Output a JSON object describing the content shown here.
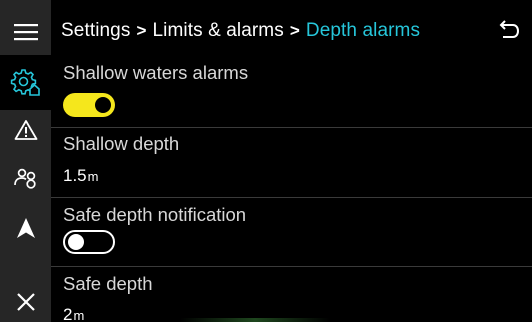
{
  "header": {
    "breadcrumb": [
      "Settings",
      "Limits & alarms",
      "Depth alarms"
    ],
    "separator": ">"
  },
  "sidebar": {
    "items": [
      {
        "icon": "menu-icon"
      },
      {
        "icon": "settings-home-icon",
        "active": true
      },
      {
        "icon": "warning-icon"
      },
      {
        "icon": "people-icon"
      },
      {
        "icon": "navigation-icon"
      },
      {
        "icon": "close-icon"
      }
    ]
  },
  "settings": {
    "shallow_alarms": {
      "label": "Shallow waters alarms",
      "enabled": true
    },
    "shallow_depth": {
      "label": "Shallow depth",
      "value": "1.5",
      "unit": "m"
    },
    "safe_notification": {
      "label": "Safe depth notification",
      "enabled": false
    },
    "safe_depth": {
      "label": "Safe depth",
      "value": "2",
      "unit": "m"
    }
  },
  "colors": {
    "accent": "#26c6da",
    "toggle_on": "#f5e71c",
    "sidebar_bg": "#262626",
    "background": "#000000"
  }
}
